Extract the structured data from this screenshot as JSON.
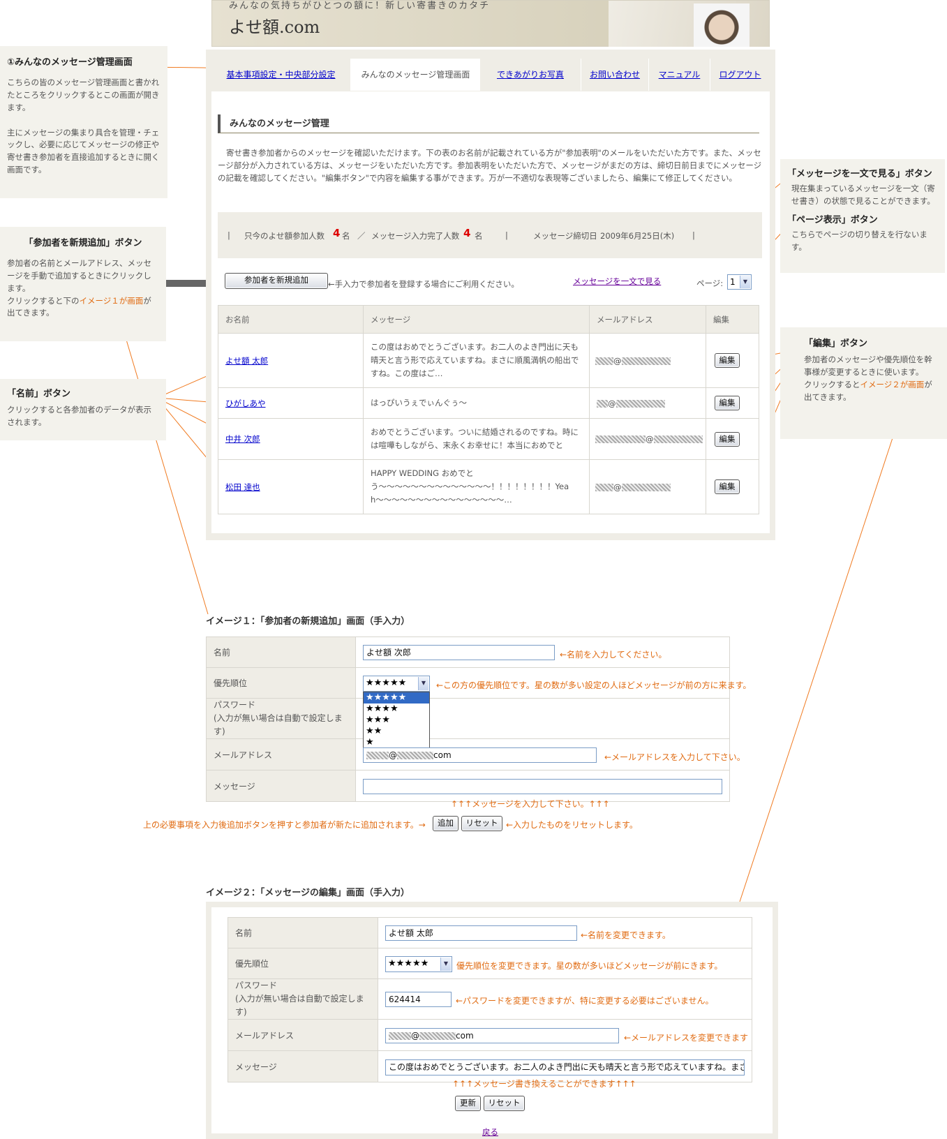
{
  "header": {
    "tagline": "みんなの気持ちがひとつの額に！新しい寄書きのカタチ",
    "logo": "よせ額.com"
  },
  "tabs": [
    {
      "label": "基本事項設定・中央部分設定"
    },
    {
      "label": "みんなのメッセージ管理画面"
    },
    {
      "label": "できあがりお写真"
    },
    {
      "label": "お問い合わせ"
    },
    {
      "label": "マニュアル"
    },
    {
      "label": "ログアウト"
    }
  ],
  "main": {
    "section_title": "みんなのメッセージ管理",
    "intro": "寄せ書き参加者からのメッセージを確認いただけます。下の表のお名前が記載されている方が\"参加表明\"のメールをいただいた方です。また、メッセージ部分が入力されている方は、メッセージをいただいた方です。参加表明をいただいた方で、メッセージがまだの方は、締切日前日までにメッセージの記載を確認してください。\"編集ボタン\"で内容を編集する事ができます。万が一不適切な表現等ございましたら、編集にて修正してください。",
    "stats": {
      "sep": "|",
      "participants_label": "只今のよせ額参加人数",
      "participants": "4",
      "unit": "名",
      "slash": "／",
      "completed_label": "メッセージ入力完了人数",
      "completed": "4",
      "deadline_label": "メッセージ締切日",
      "deadline": "2009年6月25日(木)"
    },
    "add_button": "参加者を新規追加",
    "add_hint": "←手入力で参加者を登録する場合にご利用ください。",
    "view_all_link": "メッセージを一文で見る",
    "page_label": "ページ:",
    "page_value": "1",
    "columns": [
      "お名前",
      "メッセージ",
      "メールアドレス",
      "編集"
    ],
    "rows": [
      {
        "name": "よせ額 太郎",
        "message": "この度はおめでとうございます。お二人のよき門出に天も晴天と言う形で応えていますね。まさに順風満帆の船出ですね。この度はご…",
        "edit": "編集"
      },
      {
        "name": "ひがしあや",
        "message": "はっぴいうぇでぃんぐぅ〜",
        "edit": "編集"
      },
      {
        "name": "中井 次郎",
        "message": "おめでとうございます。ついに結婚されるのですね。時には喧嘩もしながら、末永くお幸せに！本当におめでと",
        "edit": "編集"
      },
      {
        "name": "松田 達也",
        "message": "HAPPY WEDDING おめでとう〜〜〜〜〜〜〜〜〜〜〜〜〜〜！！！！！！！！Yeah〜〜〜〜〜〜〜〜〜〜〜〜〜〜〜〜…",
        "edit": "編集"
      }
    ],
    "at": "@"
  },
  "annotations": {
    "a1": {
      "title": "①みんなのメッセージ管理画面",
      "p1": "こちらの皆のメッセージ管理画面と書かれたところをクリックするとこの画面が開きます。",
      "p2": "主にメッセージの集まり具合を管理・チェックし、必要に応じてメッセージの修正や寄せ書き参加者を直接追加するときに開く画面です。"
    },
    "a2": {
      "title": "「参加者を新規追加」ボタン",
      "p1": "参加者の名前とメールアドレス、メッセージを手動で追加するときにクリックします。",
      "p2a": "クリックすると下の",
      "p2b": "イメージ１が画面",
      "p2c": "が出てきます。"
    },
    "a3": {
      "title": "「名前」ボタン",
      "p1": "クリックすると各参加者のデータが表示されます。"
    },
    "a4": {
      "title1": "「メッセージを一文で見る」ボタン",
      "p1": "現在集まっているメッセージを一文（寄せ書き）の状態で見ることができます。",
      "title2": "「ページ表示」ボタン",
      "p2": "こちらでページの切り替えを行ないます。"
    },
    "a5": {
      "title": "「編集」ボタン",
      "p1": "参加者のメッセージや優先順位を幹事様が変更するときに使います。",
      "p2a": "クリックすると",
      "p2b": "イメージ２が画面",
      "p2c": "が出てきます。"
    }
  },
  "image1": {
    "title": "イメージ１：「参加者の新規追加」画面（手入力）",
    "labels": {
      "name": "名前",
      "priority": "優先順位",
      "password": "パスワード",
      "password_sub": "(入力が無い場合は自動で設定します)",
      "email": "メールアドレス",
      "message": "メッセージ"
    },
    "name_value": "よせ額 次郎",
    "priority_value": "★★★★★",
    "priority_options": [
      "★★★★★",
      "★★★★",
      "★★★",
      "★★",
      "★"
    ],
    "email_suffix": "com",
    "notes": {
      "name": "←名前を入力してください。",
      "priority": "←この方の優先順位です。星の数が多い設定の人ほどメッセージが前の方に来ます。",
      "email": "←メールアドレスを入力して下さい。",
      "message": "↑↑↑メッセージを入力して下さい。↑↑↑",
      "add_left": "上の必要事項を入力後追加ボタンを押すと参加者が新たに追加されます。→",
      "reset_right": "←入力したものをリセットします。"
    },
    "add_button": "追加",
    "reset_button": "リセット"
  },
  "image2": {
    "title": "イメージ２：「メッセージの編集」画面（手入力）",
    "labels": {
      "name": "名前",
      "priority": "優先順位",
      "password": "パスワード",
      "password_sub": "(入力が無い場合は自動で設定します)",
      "email": "メールアドレス",
      "message": "メッセージ"
    },
    "name_value": "よせ額 太郎",
    "priority_value": "★★★★★",
    "password_value": "624414",
    "email_suffix": "com",
    "message_value": "この度はおめでとうございます。お二人のよき門出に天も晴天と言う形で応えていますね。まさに",
    "notes": {
      "name": "←名前を変更できます。",
      "priority": "優先順位を変更できます。星の数が多いほどメッセージが前にきます。",
      "password": "←パスワードを変更できますが、特に変更する必要はございません。",
      "email": "←メールアドレスを変更できます",
      "message": "↑↑↑メッセージ書き換えることができます↑↑↑"
    },
    "update_button": "更新",
    "reset_button": "リセット",
    "back_link": "戻る"
  },
  "colors": {
    "accent": "#e06a10",
    "link": "#0000cc",
    "panel": "#efede6",
    "red": "#dd0000"
  }
}
